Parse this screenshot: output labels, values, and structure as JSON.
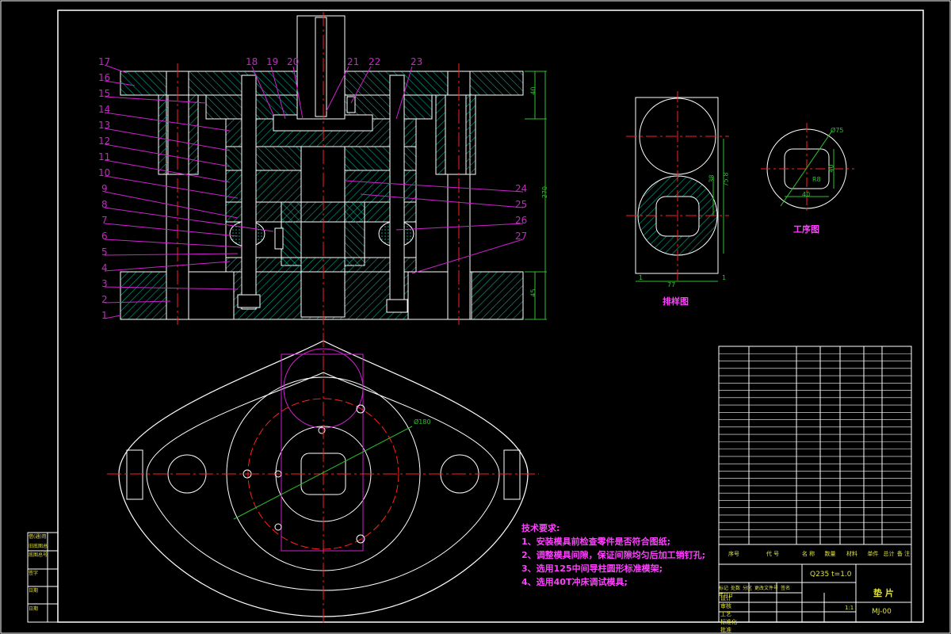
{
  "colors": {
    "background": "#000000",
    "frame": "#ffffff",
    "hatch": "#00a88f",
    "center_line": "#ff2020",
    "leader": "#d020d0",
    "dimension": "#30c030",
    "text_yellow": "#e0e040",
    "text_magenta": "#ff40ff"
  },
  "part_labels": [
    "1",
    "2",
    "3",
    "4",
    "5",
    "6",
    "7",
    "8",
    "9",
    "10",
    "11",
    "12",
    "13",
    "14",
    "15",
    "16",
    "17",
    "18",
    "19",
    "20",
    "21",
    "22",
    "23",
    "24",
    "25",
    "26",
    "27"
  ],
  "section_view": {
    "dim_top": "40",
    "dim_total": "270",
    "dim_bottom": "45"
  },
  "layout_view": {
    "title": "排样图",
    "dim_width": "77",
    "dim_height": "75.8",
    "dim_gap_left": "1",
    "dim_gap_right": "1",
    "dim_step": "38"
  },
  "part_view": {
    "title": "工序图",
    "dim_outer": "Ø75",
    "dim_inner": "40",
    "dim_radius": "R8",
    "dim_side": "40"
  },
  "plan_view": {
    "dim_circle": "Ø180"
  },
  "tech_req": {
    "heading": "技术要求:",
    "items": [
      "1、安装模具前检查零件是否符合图纸;",
      "2、调整模具间隙，保证间隙均匀后加工销钉孔;",
      "3、选用125中间导柱圆形标准模架;",
      "4、选用40T冲床调试模具;"
    ]
  },
  "title_block": {
    "drawing_name": "垫 片",
    "drawing_no": "MJ-00",
    "material_spec": "Q235  t=1.0",
    "ratio": "1:1",
    "header_labels": [
      "序号",
      "代 号",
      "名 称",
      "数量",
      "材料",
      "单件",
      "总计",
      "备 注"
    ],
    "bottom_labels": [
      "标记",
      "处数",
      "分区",
      "更改文件号",
      "签名",
      "年月日"
    ],
    "row_labels": [
      "设计",
      "审核",
      "工艺",
      "标准化",
      "批准"
    ]
  },
  "left_stamp": [
    "借(通)用件登记",
    "旧底图总号",
    "底图总号",
    "签字",
    "日期",
    "日期"
  ]
}
